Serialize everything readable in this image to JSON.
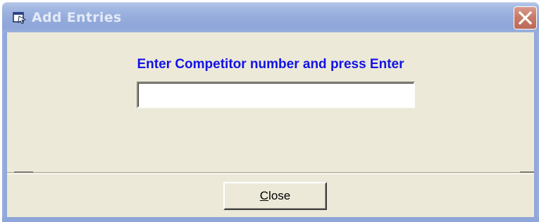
{
  "window": {
    "title": "Add Entries",
    "close_icon": "close-x-icon",
    "app_icon": "window-app-icon"
  },
  "form": {
    "prompt": "Enter Competitor number and press Enter",
    "competitor_number": {
      "value": "",
      "placeholder": ""
    }
  },
  "buttons": {
    "close": {
      "accel": "C",
      "rest": "lose"
    }
  },
  "colors": {
    "prompt_text": "#1212e6",
    "dialog_bg": "#ece9d8",
    "titlebar": "#94abdb",
    "close_red": "#c87b69"
  }
}
